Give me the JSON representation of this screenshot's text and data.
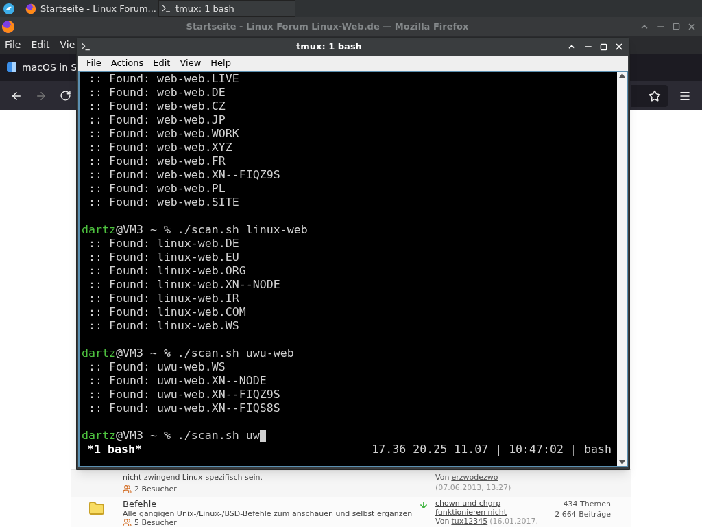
{
  "taskbar": {
    "tasks": [
      {
        "kind": "browser",
        "title": "Startseite - Linux Forum...",
        "selected": false
      },
      {
        "kind": "terminal",
        "title": "tmux: 1 bash",
        "selected": true
      }
    ]
  },
  "firefox": {
    "title": "Startseite - Linux Forum Linux-Web.de — Mozilla Firefox",
    "menu": [
      "File",
      "Edit",
      "Vie"
    ],
    "tab": "macOS in S",
    "forum_rows": [
      {
        "description": "nicht zwingend Linux-spezifisch sein.",
        "visitors": "2 Besucher",
        "last_by": "Von",
        "last_user": "erzwodezwo",
        "last_date": "(07.06.2013, 13:27)"
      },
      {
        "title": "Befehle",
        "description": "Alle gängigen Unix-/Linux-/BSD-Befehle zum anschauen und selbst ergänzen",
        "visitors": "5 Besucher",
        "last_post": "chown und chgrp funktionieren nicht",
        "last_by": "Von",
        "last_user": "tux12345",
        "last_date": "(16.01.2017,",
        "threads": "434 Themen",
        "posts": "2 664 Beiträge"
      }
    ]
  },
  "terminal": {
    "title": "tmux: 1 bash",
    "menu": [
      "File",
      "Actions",
      "Edit",
      "View",
      "Help"
    ],
    "lines": [
      {
        "kind": "output",
        "text": " :: Found: web-web.LIVE"
      },
      {
        "kind": "output",
        "text": " :: Found: web-web.DE"
      },
      {
        "kind": "output",
        "text": " :: Found: web-web.CZ"
      },
      {
        "kind": "output",
        "text": " :: Found: web-web.JP"
      },
      {
        "kind": "output",
        "text": " :: Found: web-web.WORK"
      },
      {
        "kind": "output",
        "text": " :: Found: web-web.XYZ"
      },
      {
        "kind": "output",
        "text": " :: Found: web-web.FR"
      },
      {
        "kind": "output",
        "text": " :: Found: web-web.XN--FIQZ9S"
      },
      {
        "kind": "output",
        "text": " :: Found: web-web.PL"
      },
      {
        "kind": "output",
        "text": " :: Found: web-web.SITE"
      },
      {
        "kind": "blank"
      },
      {
        "kind": "prompt",
        "user": "dartz",
        "text": "@VM3 ~ % ./scan.sh linux-web",
        "cursor": false
      },
      {
        "kind": "output",
        "text": " :: Found: linux-web.DE"
      },
      {
        "kind": "output",
        "text": " :: Found: linux-web.EU"
      },
      {
        "kind": "output",
        "text": " :: Found: linux-web.ORG"
      },
      {
        "kind": "output",
        "text": " :: Found: linux-web.XN--NODE"
      },
      {
        "kind": "output",
        "text": " :: Found: linux-web.IR"
      },
      {
        "kind": "output",
        "text": " :: Found: linux-web.COM"
      },
      {
        "kind": "output",
        "text": " :: Found: linux-web.WS"
      },
      {
        "kind": "blank"
      },
      {
        "kind": "prompt",
        "user": "dartz",
        "text": "@VM3 ~ % ./scan.sh uwu-web",
        "cursor": false
      },
      {
        "kind": "output",
        "text": " :: Found: uwu-web.WS"
      },
      {
        "kind": "output",
        "text": " :: Found: uwu-web.XN--NODE"
      },
      {
        "kind": "output",
        "text": " :: Found: uwu-web.XN--FIQZ9S"
      },
      {
        "kind": "output",
        "text": " :: Found: uwu-web.XN--FIQS8S"
      },
      {
        "kind": "blank"
      },
      {
        "kind": "prompt",
        "user": "dartz",
        "text": "@VM3 ~ % ./scan.sh uw",
        "cursor": true
      }
    ],
    "status": {
      "window": "*1 bash*",
      "info": "17.36 20.25 11.07 | 10:47:02 | bash"
    }
  }
}
